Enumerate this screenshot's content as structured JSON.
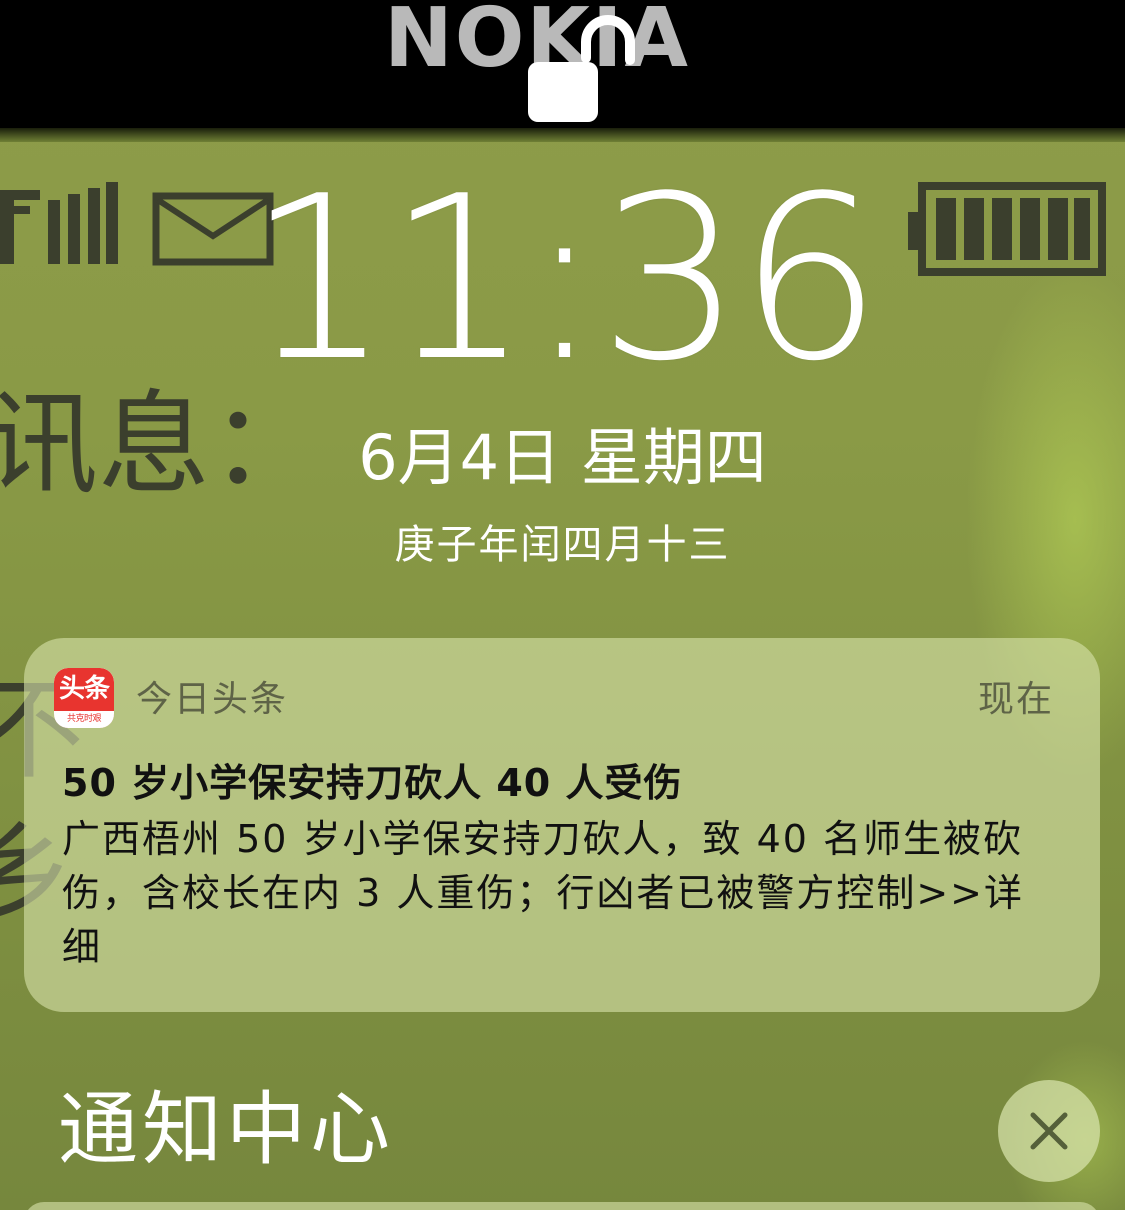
{
  "wallpaper": {
    "brand_text": "NOKIA",
    "screen_text_1": "讯息：",
    "screen_text_2": "不",
    "screen_text_3": "乡",
    "colors": {
      "lcd_green": "#8a9a46",
      "lcd_ink": "#3b3f2d",
      "bezel": "#000000",
      "brand_gray": "#b9b9b9"
    },
    "icons": [
      "signal-strength-icon",
      "envelope-icon",
      "battery-icon"
    ]
  },
  "lockscreen": {
    "lock_icon": "unlocked-padlock-icon",
    "time": "11:36",
    "date": "6月4日 星期四",
    "lunar_date": "庚子年闰四月十三"
  },
  "notification": {
    "app_name": "今日头条",
    "app_icon": {
      "logo_text": "头条",
      "slogan": "共克时艰",
      "color": "#e8342f"
    },
    "time": "现在",
    "title": "50 岁小学保安持刀砍人 40 人受伤",
    "body": "广西梧州 50 岁小学保安持刀砍人，致 40 名师生被砍伤，含校长在内 3 人重伤；行凶者已被警方控制>>详细"
  },
  "notification_center": {
    "title": "通知中心",
    "clear_icon": "close-icon"
  }
}
